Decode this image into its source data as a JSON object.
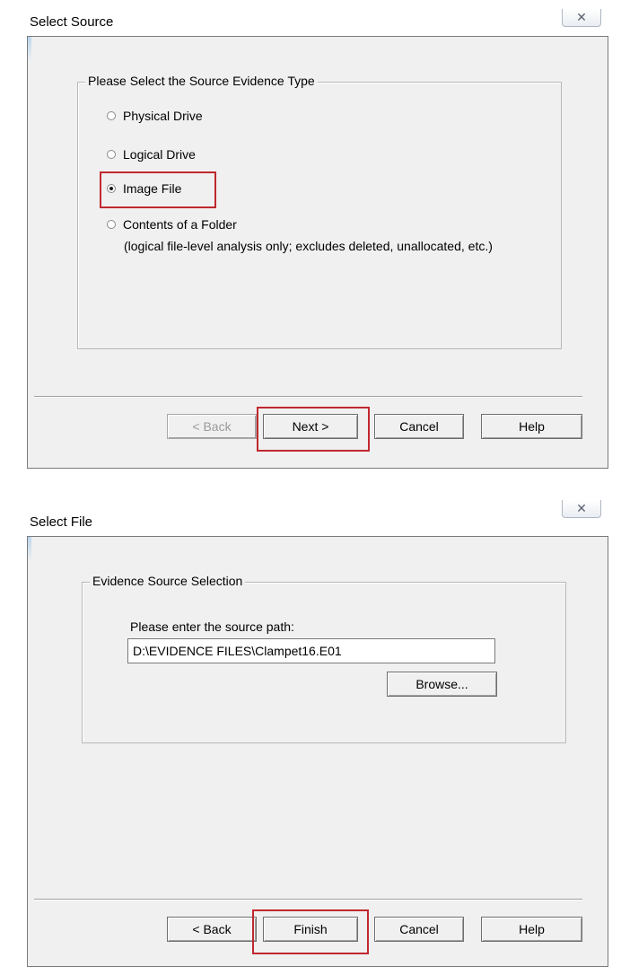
{
  "dialog1": {
    "title": "Select Source",
    "close_glyph": "✕",
    "group_legend": "Please Select the Source Evidence Type",
    "options": [
      {
        "label": "Physical Drive",
        "checked": false
      },
      {
        "label": "Logical Drive",
        "checked": false
      },
      {
        "label": "Image File",
        "checked": true
      },
      {
        "label": "Contents of a Folder",
        "checked": false
      }
    ],
    "folder_note": "(logical file-level analysis only; excludes deleted, unallocated, etc.)",
    "buttons": {
      "back": "< Back",
      "next": "Next >",
      "cancel": "Cancel",
      "help": "Help"
    }
  },
  "dialog2": {
    "title": "Select File",
    "close_glyph": "✕",
    "group_legend": "Evidence Source Selection",
    "path_label": "Please enter the source path:",
    "path_value": "D:\\EVIDENCE FILES\\Clampet16.E01",
    "browse_label": "Browse...",
    "buttons": {
      "back": "< Back",
      "finish": "Finish",
      "cancel": "Cancel",
      "help": "Help"
    }
  },
  "colors": {
    "highlight": "#c0282e",
    "dialog_bg": "#f0f0f0"
  }
}
